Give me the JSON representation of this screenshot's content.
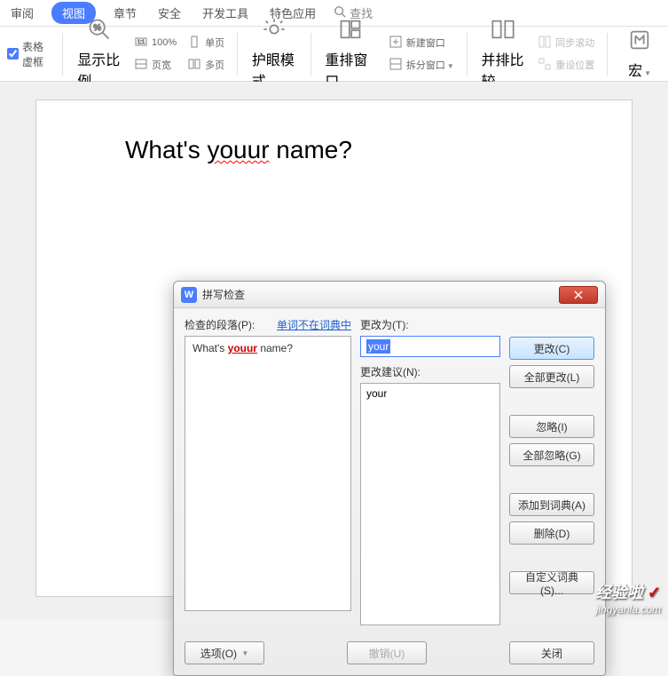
{
  "menubar": {
    "items": [
      "审阅",
      "视图",
      "章节",
      "安全",
      "开发工具",
      "特色应用"
    ],
    "active_index": 1,
    "search_label": "查找"
  },
  "ribbon": {
    "checkbox_label": "表格虚框",
    "zoom": {
      "ratio_label": "显示比例",
      "percent": "100%",
      "pagewidth": "页宽"
    },
    "page": {
      "single": "单页",
      "multi": "多页"
    },
    "eyecare": "护眼模式",
    "rearrange": "重排窗口",
    "newwin": "新建窗口",
    "splitwin": "拆分窗口",
    "compare": "并排比较",
    "syncscroll": "同步滚动",
    "resetpos": "重设位置",
    "macro": "宏"
  },
  "document": {
    "text_before": "What's ",
    "misspelled": "youur",
    "text_after": " name?"
  },
  "dialog": {
    "title": "拼写检查",
    "paragraph_label": "检查的段落(P):",
    "not_in_dict_label": "单词不在词典中",
    "change_to_label": "更改为(T):",
    "suggestions_label": "更改建议(N):",
    "paragraph_before": "What's ",
    "paragraph_error": "youur",
    "paragraph_after": " name?",
    "change_to_value": "your",
    "suggestion_item": "your",
    "buttons": {
      "change": "更改(C)",
      "change_all": "全部更改(L)",
      "ignore": "忽略(I)",
      "ignore_all": "全部忽略(G)",
      "add_to_dict": "添加到词典(A)",
      "delete": "删除(D)",
      "custom_dict": "自定义词典(S)...",
      "options": "选项(O)",
      "undo": "撤销(U)",
      "close": "关闭"
    }
  },
  "watermark": {
    "brand": "经验啦",
    "url": "jingyanla.com"
  }
}
